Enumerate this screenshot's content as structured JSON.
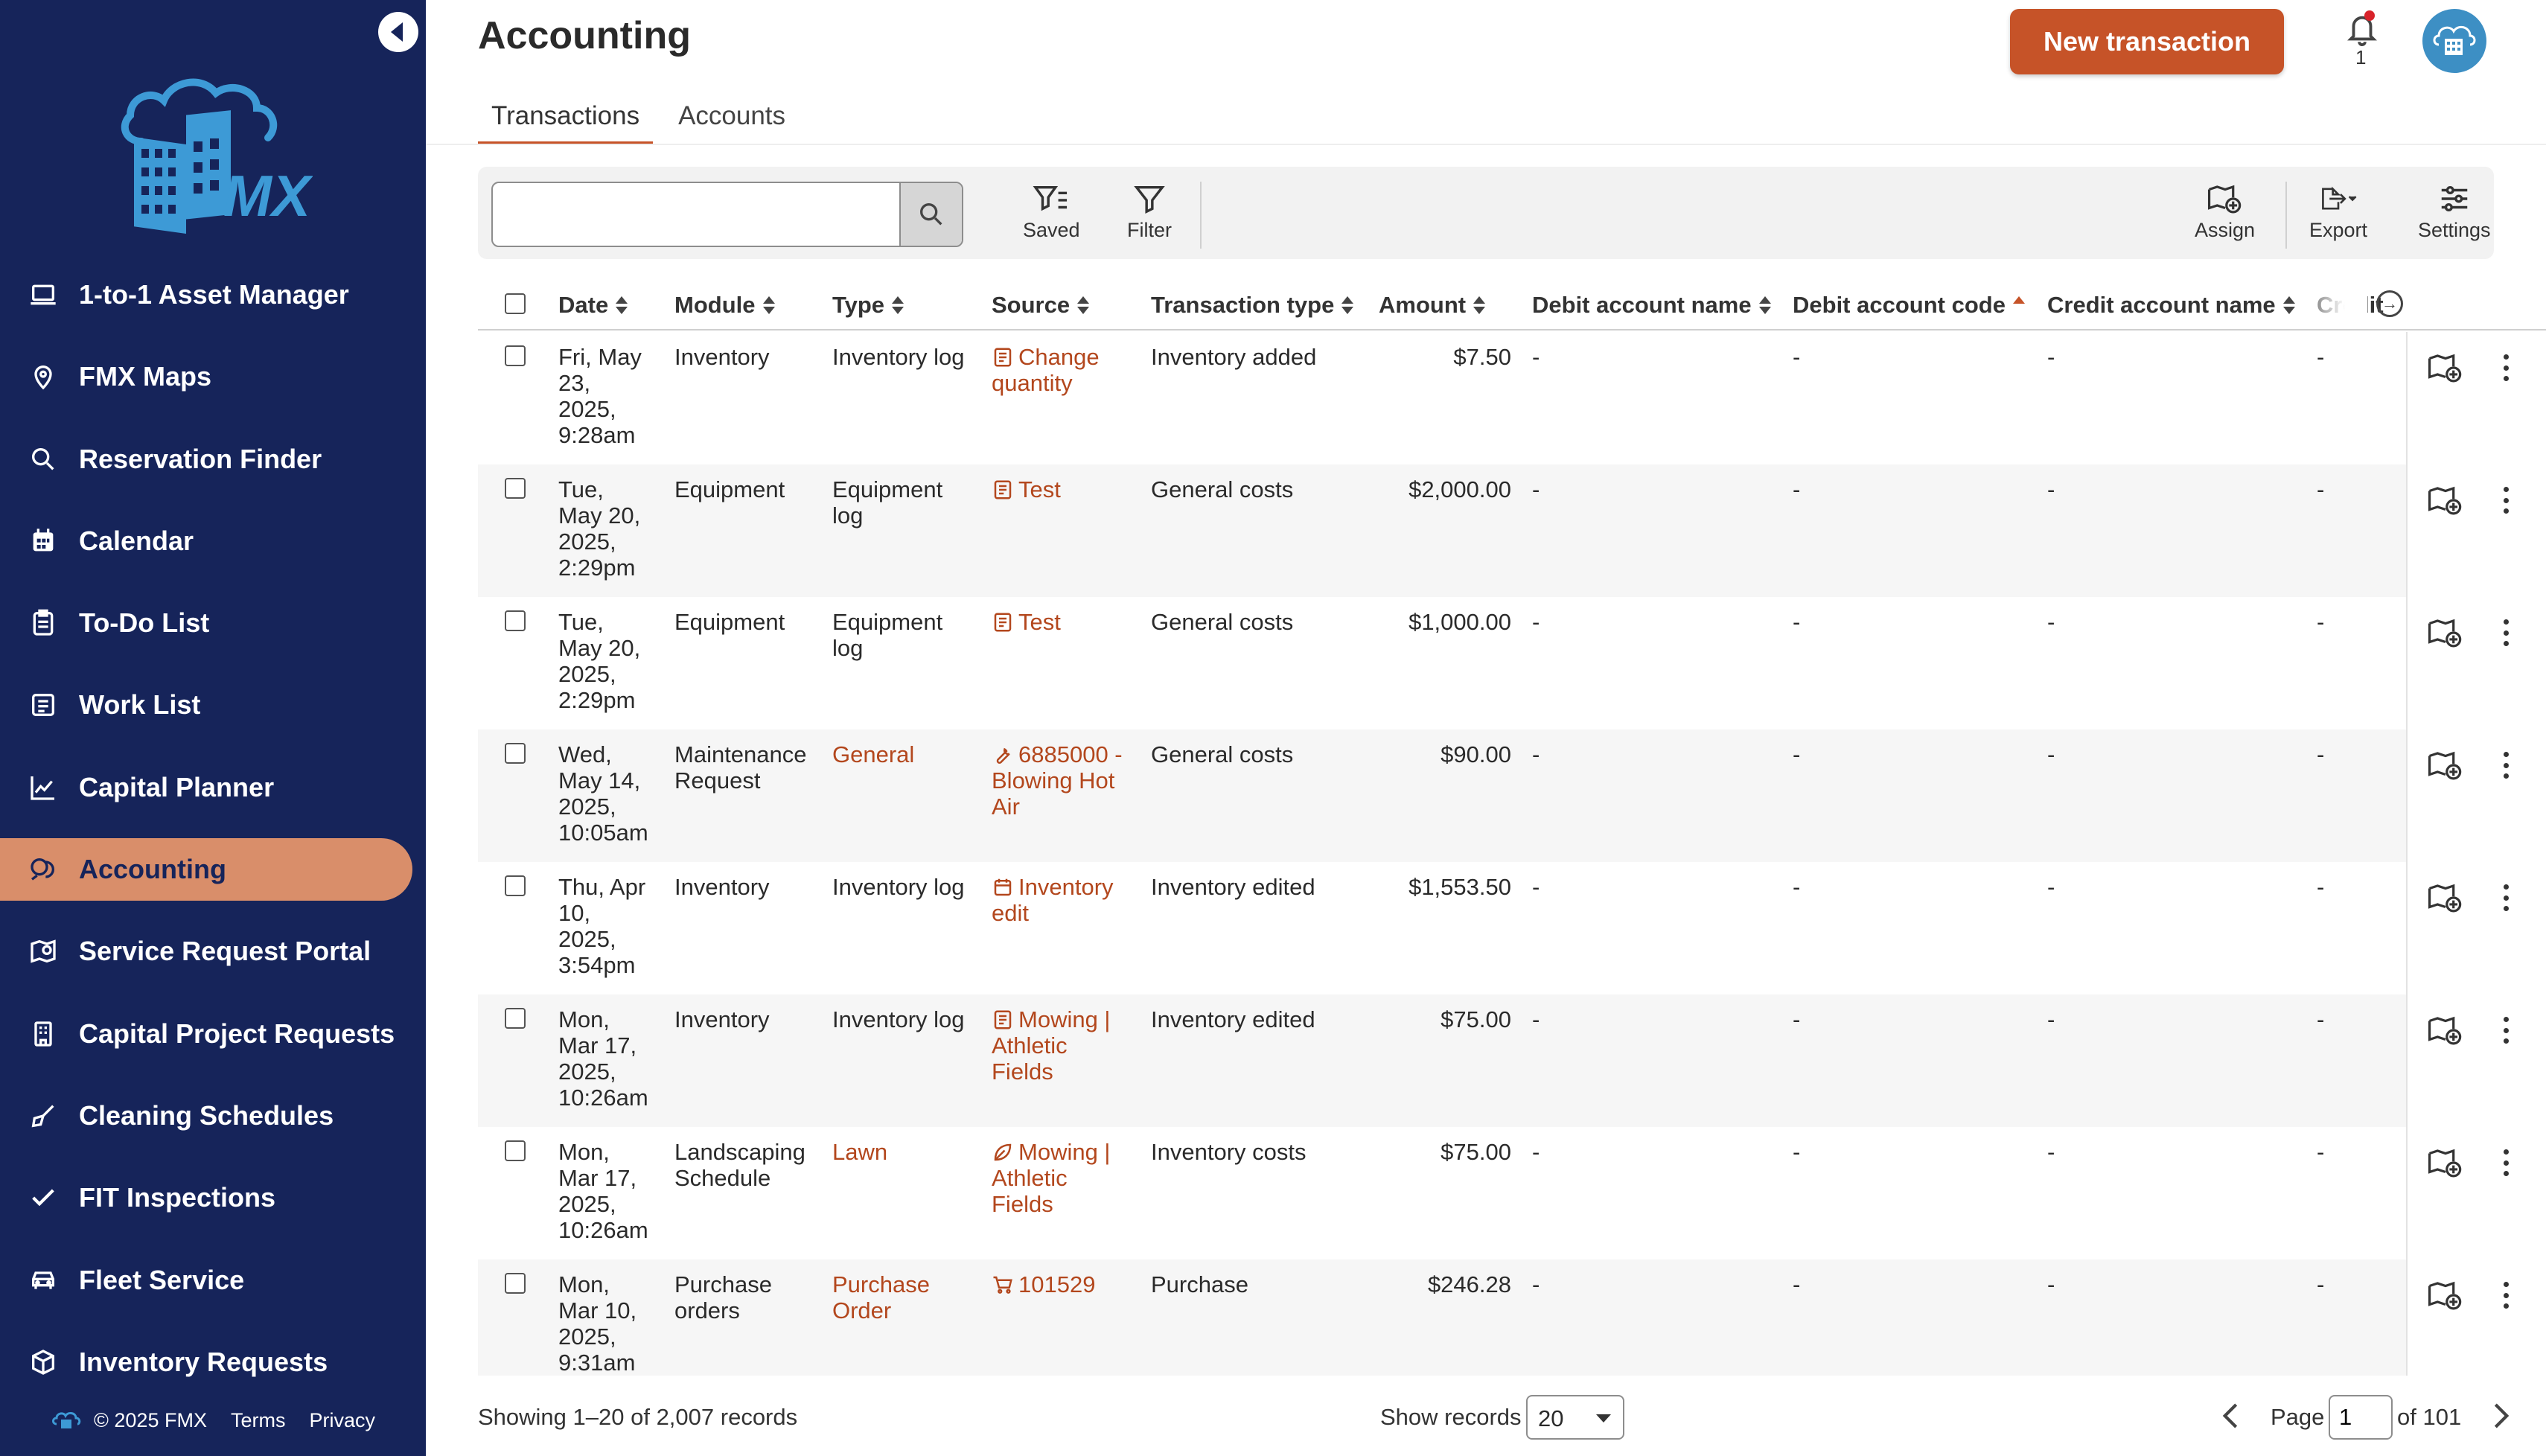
{
  "sidebar": {
    "collapse_icon": "chevron-left-icon",
    "logo_text": "FMX",
    "items": [
      {
        "label": "1-to-1 Asset Manager",
        "icon": "laptop-icon"
      },
      {
        "label": "FMX Maps",
        "icon": "map-pin-icon"
      },
      {
        "label": "Reservation Finder",
        "icon": "search-icon"
      },
      {
        "label": "Calendar",
        "icon": "calendar-icon"
      },
      {
        "label": "To-Do List",
        "icon": "clipboard-icon"
      },
      {
        "label": "Work List",
        "icon": "list-icon"
      },
      {
        "label": "Capital Planner",
        "icon": "chart-line-icon"
      },
      {
        "label": "Accounting",
        "icon": "accounting-icon",
        "active": true
      },
      {
        "label": "Service Request Portal",
        "icon": "portal-icon"
      },
      {
        "label": "Capital Project Requests",
        "icon": "building-icon"
      },
      {
        "label": "Cleaning Schedules",
        "icon": "broom-icon"
      },
      {
        "label": "FIT Inspections",
        "icon": "check-icon"
      },
      {
        "label": "Fleet Service",
        "icon": "car-icon"
      },
      {
        "label": "Inventory Requests",
        "icon": "box-icon"
      }
    ],
    "footer": {
      "copyright": "© 2025 FMX",
      "terms": "Terms",
      "privacy": "Privacy"
    }
  },
  "header": {
    "title": "Accounting",
    "new_button": "New transaction",
    "notification_count": "1"
  },
  "tabs": [
    {
      "label": "Transactions",
      "active": true
    },
    {
      "label": "Accounts",
      "active": false
    }
  ],
  "toolbar": {
    "search_placeholder": "",
    "saved": "Saved",
    "filter": "Filter",
    "assign": "Assign",
    "export": "Export",
    "settings": "Settings"
  },
  "table": {
    "columns": [
      "Date",
      "Module",
      "Type",
      "Source",
      "Transaction type",
      "Amount",
      "Debit account name",
      "Debit account code",
      "Credit account name",
      "Credit"
    ],
    "rows": [
      {
        "date": "Fri, May\n23,\n2025,\n9:28am",
        "module": "Inventory",
        "type": "Inventory log",
        "type_link": false,
        "source": "Change\nquantity",
        "source_icon": "document-icon",
        "transaction_type": "Inventory added",
        "amount": "$7.50",
        "debit_name": "-",
        "debit_code": "-",
        "credit_name": "-",
        "credit": "-"
      },
      {
        "date": "Tue,\nMay 20,\n2025,\n2:29pm",
        "module": "Equipment",
        "type": "Equipment\nlog",
        "type_link": false,
        "source": "Test",
        "source_icon": "document-icon",
        "transaction_type": "General costs",
        "amount": "$2,000.00",
        "debit_name": "-",
        "debit_code": "-",
        "credit_name": "-",
        "credit": "-"
      },
      {
        "date": "Tue,\nMay 20,\n2025,\n2:29pm",
        "module": "Equipment",
        "type": "Equipment\nlog",
        "type_link": false,
        "source": "Test",
        "source_icon": "document-icon",
        "transaction_type": "General costs",
        "amount": "$1,000.00",
        "debit_name": "-",
        "debit_code": "-",
        "credit_name": "-",
        "credit": "-"
      },
      {
        "date": "Wed,\nMay 14,\n2025,\n10:05am",
        "module": "Maintenance\nRequest",
        "type": "General",
        "type_link": true,
        "source": "6885000 -\nBlowing Hot\nAir",
        "source_icon": "wrench-icon",
        "transaction_type": "General costs",
        "amount": "$90.00",
        "debit_name": "-",
        "debit_code": "-",
        "credit_name": "-",
        "credit": "-"
      },
      {
        "date": "Thu, Apr\n10,\n2025,\n3:54pm",
        "module": "Inventory",
        "type": "Inventory log",
        "type_link": false,
        "source": "Inventory\nedit",
        "source_icon": "calendar-icon",
        "transaction_type": "Inventory edited",
        "amount": "$1,553.50",
        "debit_name": "-",
        "debit_code": "-",
        "credit_name": "-",
        "credit": "-"
      },
      {
        "date": "Mon,\nMar 17,\n2025,\n10:26am",
        "module": "Inventory",
        "type": "Inventory log",
        "type_link": false,
        "source": "Mowing |\nAthletic\nFields",
        "source_icon": "document-icon",
        "transaction_type": "Inventory edited",
        "amount": "$75.00",
        "debit_name": "-",
        "debit_code": "-",
        "credit_name": "-",
        "credit": "-"
      },
      {
        "date": "Mon,\nMar 17,\n2025,\n10:26am",
        "module": "Landscaping\nSchedule",
        "type": "Lawn",
        "type_link": true,
        "source": "Mowing |\nAthletic\nFields",
        "source_icon": "leaf-icon",
        "transaction_type": "Inventory costs",
        "amount": "$75.00",
        "debit_name": "-",
        "debit_code": "-",
        "credit_name": "-",
        "credit": "-"
      },
      {
        "date": "Mon,\nMar 10,\n2025,\n9:31am",
        "module": "Purchase\norders",
        "type": "Purchase\nOrder",
        "type_link": true,
        "source": "101529",
        "source_icon": "cart-icon",
        "transaction_type": "Purchase",
        "amount": "$246.28",
        "debit_name": "-",
        "debit_code": "-",
        "credit_name": "-",
        "credit": "-"
      }
    ]
  },
  "pagination": {
    "records": "Showing 1–20 of 2,007 records",
    "show_label": "Show records",
    "show_value": "20",
    "page_label": "Page",
    "page_value": "1",
    "of_label": "of 101"
  },
  "colors": {
    "sidebar_bg": "#16245a",
    "accent": "#c65328",
    "active_nav": "#d98e6a",
    "link": "#b3471d",
    "avatar": "#3d8fc4"
  }
}
